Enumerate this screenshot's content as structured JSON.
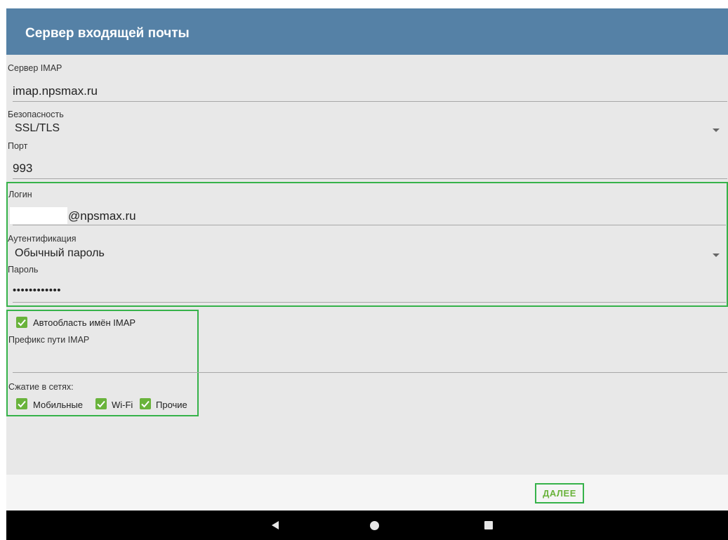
{
  "appbar": {
    "title": "Сервер входящей почты"
  },
  "form": {
    "imap_server_label": "Сервер IMAP",
    "imap_server_value": "imap.npsmax.ru",
    "security_label": "Безопасность",
    "security_value": "SSL/TLS",
    "port_label": "Порт",
    "port_value": "993",
    "login_label": "Логин",
    "login_value": "@npsmax.ru",
    "auth_label": "Аутентификация",
    "auth_value": "Обычный пароль",
    "password_label": "Пароль",
    "password_value": "••••••••••••",
    "auto_namespace_label": "Автообласть имён IMAP",
    "auto_namespace_checked": true,
    "path_prefix_label": "Префикс пути IMAP",
    "path_prefix_value": "",
    "compression_label": "Сжатие в сетях:",
    "compression_options": [
      {
        "label": "Мобильные",
        "checked": true
      },
      {
        "label": "Wi-Fi",
        "checked": true
      },
      {
        "label": "Прочие",
        "checked": true
      }
    ]
  },
  "footer": {
    "next_label": "ДАЛЕЕ"
  },
  "navbar": {
    "back_icon": "back-triangle-icon",
    "home_icon": "home-circle-icon",
    "recents_icon": "recents-square-icon"
  },
  "colors": {
    "appbar": "#5581a6",
    "accent": "#69b33b",
    "highlight": "#36b24a"
  }
}
